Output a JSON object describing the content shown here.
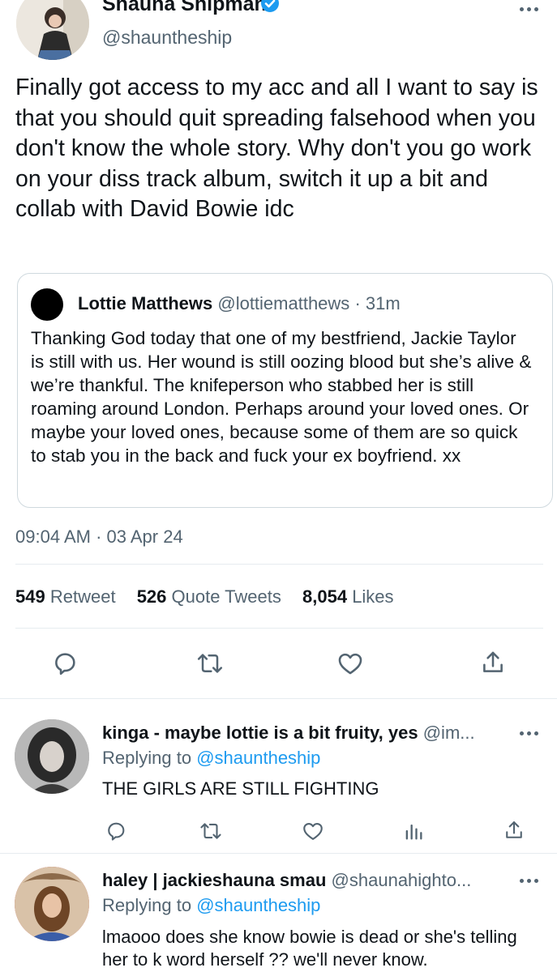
{
  "main_tweet": {
    "author_name": "Shauna Shipman",
    "author_handle": "@shauntheship",
    "text": "Finally got access to my acc and all I want to say is that you should quit spreading falsehood when you don't know the whole story. Why don't you go work on your diss track album, switch it up a bit and collab with David Bowie idc",
    "quoted": {
      "name": "Lottie Matthews",
      "handle": "@lottiematthews",
      "time": "· 31m",
      "text": "Thanking God today that one of my bestfriend, Jackie Taylor is still with us. Her wound is still oozing blood but she’s alive & we’re thankful. The knifeperson who stabbed her is still roaming around London. Perhaps around your loved ones. Or maybe your loved ones, because some of them are so quick to stab you in the back and fuck your ex boyfriend. xx"
    },
    "timestamp": "09:04 AM · 03 Apr 24",
    "stats": {
      "retweets": "549",
      "retweets_label": "Retweet",
      "quotes": "526",
      "quotes_label": "Quote Tweets",
      "likes": "8,054",
      "likes_label": "Likes"
    }
  },
  "replies": [
    {
      "name": "kinga - maybe lottie is a bit fruity, yes",
      "handle": "@im...",
      "replying_prefix": "Replying to",
      "replying_handle": "@shauntheship",
      "text": "THE GIRLS ARE STILL FIGHTING"
    },
    {
      "name": "haley | jackieshauna smau",
      "handle": "@shaunahighto...",
      "replying_prefix": "Replying to",
      "replying_handle": "@shauntheship",
      "text": "lmaooo does she know bowie is dead or she's telling her to k word herself ?? we'll never know."
    }
  ],
  "icons": [
    "verified-badge-icon",
    "more-icon",
    "reply-icon",
    "retweet-icon",
    "like-icon",
    "share-icon",
    "analytics-icon"
  ],
  "colors": {
    "accent": "#1d9bf0",
    "text": "#0f1419",
    "muted": "#536471",
    "divider": "#e6ecf0"
  }
}
